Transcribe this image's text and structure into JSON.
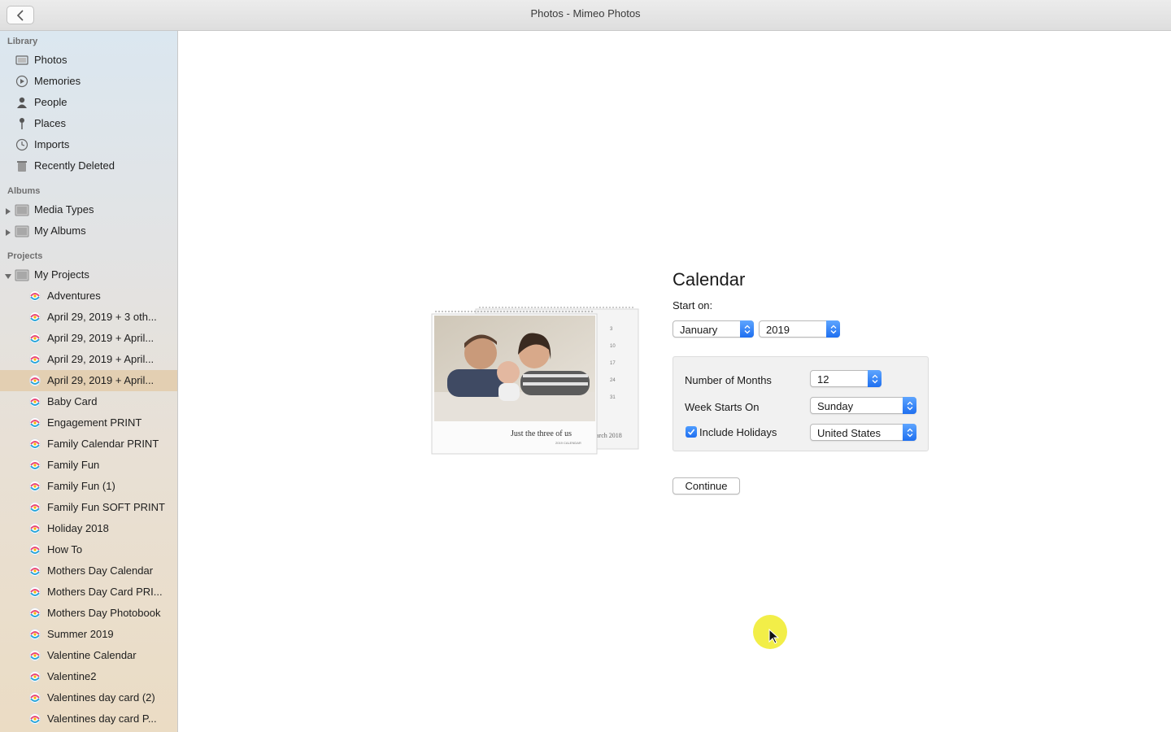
{
  "window": {
    "title": "Photos - Mimeo Photos"
  },
  "sidebar": {
    "library_header": "Library",
    "library_items": [
      {
        "label": "Photos",
        "icon": "photos-icon"
      },
      {
        "label": "Memories",
        "icon": "memories-icon"
      },
      {
        "label": "People",
        "icon": "people-icon"
      },
      {
        "label": "Places",
        "icon": "places-pin-icon"
      },
      {
        "label": "Imports",
        "icon": "imports-clock-icon"
      },
      {
        "label": "Recently Deleted",
        "icon": "trash-icon"
      }
    ],
    "albums_header": "Albums",
    "album_items": [
      {
        "label": "Media Types",
        "icon": "folder-icon",
        "expanded": false
      },
      {
        "label": "My Albums",
        "icon": "folder-icon",
        "expanded": false
      }
    ],
    "projects_header": "Projects",
    "projects_folder": {
      "label": "My Projects",
      "icon": "folder-icon",
      "expanded": true
    },
    "projects": [
      "Adventures",
      "April 29, 2019 + 3 oth...",
      "April 29, 2019 + April...",
      "April 29, 2019 + April...",
      "April 29, 2019 + April...",
      "Baby Card",
      "Engagement PRINT",
      "Family Calendar PRINT",
      "Family Fun",
      "Family Fun (1)",
      "Family Fun SOFT PRINT",
      "Holiday 2018",
      "How To",
      "Mothers Day Calendar",
      "Mothers Day Card PRI...",
      "Mothers Day Photobook",
      "Summer 2019",
      "Valentine Calendar",
      "Valentine2",
      "Valentines day card (2)",
      "Valentines day card P..."
    ],
    "selected_project": "April 29, 2019 + April...",
    "project_icon": "mimeo-project-icon"
  },
  "calendar_form": {
    "title": "Calendar",
    "start_label": "Start on:",
    "start_month": "January",
    "start_year": "2019",
    "num_months_label": "Number of Months",
    "num_months_value": "12",
    "week_starts_label": "Week Starts On",
    "week_starts_value": "Sunday",
    "include_holidays_label": "Include Holidays",
    "include_holidays_checked": true,
    "holidays_country": "United States",
    "continue_label": "Continue"
  },
  "preview": {
    "caption": "Just the three of us",
    "sub_caption": "2019 CALENDAR",
    "back_page_text": "arch 2018",
    "back_page_dates": [
      "3",
      "10",
      "17",
      "24",
      "31"
    ]
  },
  "colors": {
    "accent": "#1f6ff0",
    "selected_row": "#e3cfb2"
  }
}
